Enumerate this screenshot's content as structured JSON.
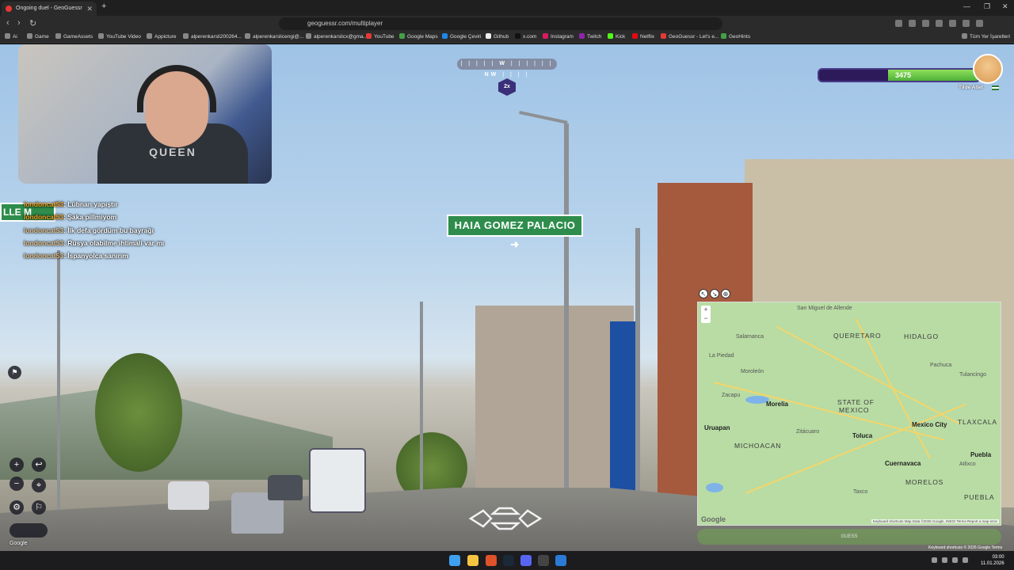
{
  "browser": {
    "tab_title": "Ongoing duel - GeoGuessr",
    "url": "geoguessr.com/multiplayer",
    "bookmarks": [
      "Ai",
      "Game",
      "GameAssets",
      "YouTube Video",
      "Appicture",
      "alperenkarsli200264...",
      "alperenkarslicengi@...",
      "alperenkarslicx@gma...",
      "YouTube",
      "Google Maps",
      "Google Çeviri",
      "Github",
      "x.com",
      "Instagram",
      "Twitch",
      "Kick",
      "Netflix",
      "GeoGuessr - Let's e...",
      "GeoHints"
    ],
    "other_bookmarks": "Tüm Yer İşaretleri"
  },
  "street": {
    "sign_main": "HAIA GOMEZ PALACIO ➜",
    "sign_left": "LLE M",
    "webcam_shirt": "QUEEN"
  },
  "hud": {
    "compass": {
      "w": "W",
      "nw": "NW"
    },
    "round_multiplier": "2x",
    "health": {
      "value": "3475",
      "fill_fraction": 0.57
    },
    "player_name": "Tilde Atlet"
  },
  "chat": [
    {
      "user": "londoncat53",
      "msg": "Lübnan yapıştır"
    },
    {
      "user": "londoncat53",
      "msg": "Şaka pillmiyom"
    },
    {
      "user": "londoncat53",
      "msg": "İlk defa gördüm bu bayrağı"
    },
    {
      "user": "londoncat53",
      "msg": "Rusya olabilme ihtimali var mı"
    },
    {
      "user": "londoncat53",
      "msg": "İspanyolca sanırım"
    }
  ],
  "map": {
    "states": [
      "QUERETARO",
      "HIDALGO",
      "STATE OF",
      "MEXICO",
      "TLAXCALA",
      "MICHOACAN",
      "MORELOS",
      "PUEBLA"
    ],
    "cities": [
      "Morelia",
      "Toluca",
      "Mexico City",
      "Cuernavaca",
      "Uruapan",
      "Puebla"
    ],
    "small_places": [
      "San Miguel de Allende",
      "Salamanca",
      "La Piedad",
      "Moroleón",
      "Zacapu",
      "Atlixco",
      "Tulancingo",
      "Pachuca",
      "Zitácuaro",
      "Taxco"
    ],
    "google": "Google",
    "attribution": "Keyboard shortcuts   Map Data ©2026 Google, INEGI   Terms   Report a map error"
  },
  "footer": {
    "google": "Google",
    "attribution": "Keyboard shortcuts  © 2026 Google  Terms",
    "guess_label": "GUESS",
    "clock_time": "03:00",
    "clock_date": "11.01.2026"
  }
}
